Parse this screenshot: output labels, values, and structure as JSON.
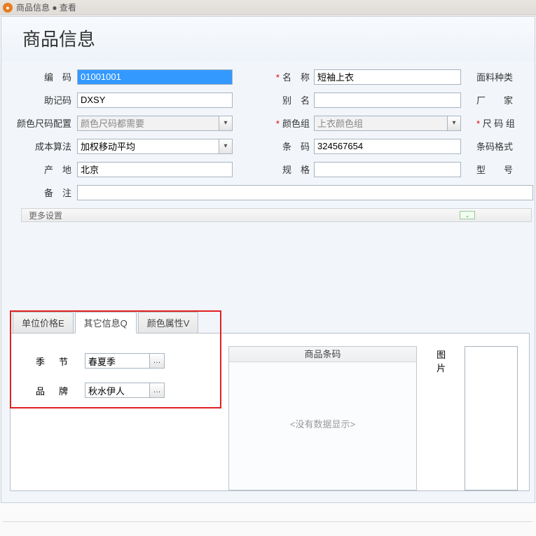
{
  "titlebar": {
    "text": "商品信息 ● 查看"
  },
  "page_title": "商品信息",
  "labels": {
    "code": "编　码",
    "mnemonic": "助记码",
    "colorsize": "颜色尺码配置",
    "cost": "成本算法",
    "origin": "产　地",
    "remark": "备　注",
    "more": "更多设置",
    "name": "名　称",
    "alias": "别　名",
    "colorgrp": "颜色组",
    "barcode": "条　码",
    "spec": "规　格",
    "fabric": "面料种类",
    "factory": "厂　　家",
    "sizegrp": "尺 码 组",
    "barfmt": "条码格式",
    "model": "型　　号"
  },
  "values": {
    "code": "01001001",
    "mnemonic": "DXSY",
    "colorsize": "颜色尺码都需要",
    "cost": "加权移动平均",
    "origin": "北京",
    "name": "短袖上衣",
    "colorgrp": "上衣颜色组",
    "barcode": "324567654"
  },
  "tabs": {
    "price": "单位价格E",
    "other": "其它信息Q",
    "colorattr": "颜色属性V"
  },
  "other": {
    "season_label": "季节",
    "season_value": "春夏季",
    "brand_label": "品牌",
    "brand_value": "秋水伊人"
  },
  "barcode_panel": {
    "title": "商品条码",
    "empty": "<没有数据显示>"
  },
  "img_panel": {
    "label": "图片"
  }
}
